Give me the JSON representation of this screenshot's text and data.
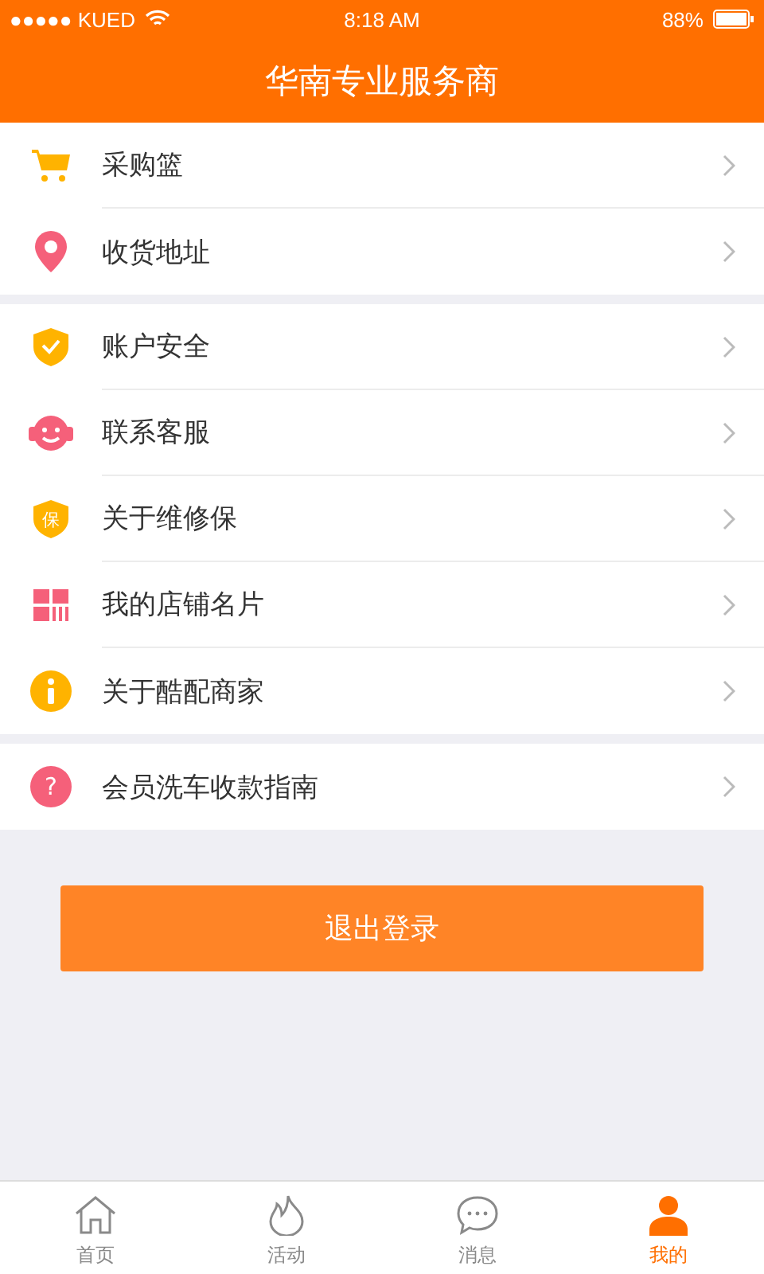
{
  "status_bar": {
    "carrier": "●●●●● KUED",
    "time": "8:18 AM",
    "battery": "88%"
  },
  "header": {
    "title": "华南专业服务商"
  },
  "groups": [
    {
      "items": [
        {
          "kind": "cart",
          "label": "采购篮"
        },
        {
          "kind": "pin",
          "label": "收货地址"
        }
      ]
    },
    {
      "items": [
        {
          "kind": "shield-check",
          "label": "账户安全"
        },
        {
          "kind": "support",
          "label": "联系客服"
        },
        {
          "kind": "shield-text",
          "label": "关于维修保",
          "icon_text": "保"
        },
        {
          "kind": "card",
          "label": "我的店铺名片"
        },
        {
          "kind": "info",
          "label": "关于酷配商家"
        }
      ]
    },
    {
      "items": [
        {
          "kind": "question",
          "label": "会员洗车收款指南",
          "icon_text": "?"
        }
      ]
    }
  ],
  "logout_button": "退出登录",
  "tab_bar": [
    {
      "kind": "home",
      "label": "首页",
      "selected": false
    },
    {
      "kind": "flame",
      "label": "活动",
      "selected": false
    },
    {
      "kind": "chat",
      "label": "消息",
      "selected": false
    },
    {
      "kind": "person",
      "label": "我的",
      "selected": true
    }
  ]
}
